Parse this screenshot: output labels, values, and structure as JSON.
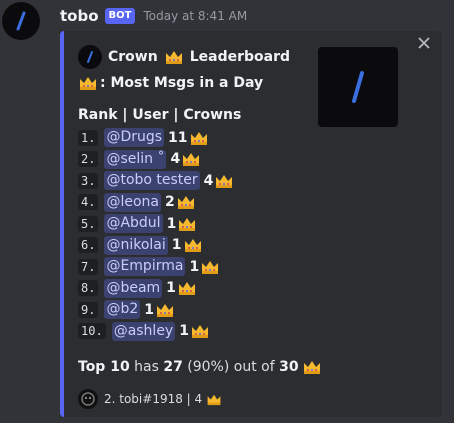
{
  "message": {
    "username": "tobo",
    "badge": "BOT",
    "timestamp": "Today at 8:41 AM"
  },
  "embed": {
    "accent_color": "#5865f2",
    "author": "Crown",
    "author_suffix": "Leaderboard",
    "title": ": Most Msgs in a Day",
    "section_header": "Rank | User | Crowns",
    "rows": [
      {
        "rank": "1.",
        "user": "@Drugs",
        "count": "11"
      },
      {
        "rank": "2.",
        "user": "@selin ˚",
        "count": "4"
      },
      {
        "rank": "3.",
        "user": "@tobo tester",
        "count": "4"
      },
      {
        "rank": "4.",
        "user": "@leona",
        "count": "2"
      },
      {
        "rank": "5.",
        "user": "@Abdul",
        "count": "1"
      },
      {
        "rank": "6.",
        "user": "@nikolai",
        "count": "1"
      },
      {
        "rank": "7.",
        "user": "@Empirma",
        "count": "1"
      },
      {
        "rank": "8.",
        "user": "@beam",
        "count": "1"
      },
      {
        "rank": "9.",
        "user": "@b2",
        "count": "1"
      },
      {
        "rank": "10.",
        "user": "@ashley",
        "count": "1"
      }
    ],
    "summary": {
      "prefix": "Top 10",
      "has": " has ",
      "value": "27",
      "percent": " (90%) out of ",
      "total": "30"
    },
    "footer": "2. tobi#1918 | 4"
  },
  "icons": {
    "close": "close-icon",
    "crown": "crown-icon",
    "logo": "slash-logo-icon"
  }
}
